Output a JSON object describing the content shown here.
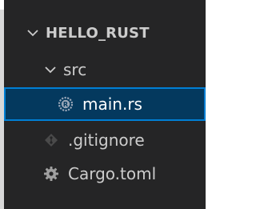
{
  "explorer": {
    "root": {
      "label": "HELLO_RUST",
      "icon": "chevron-down-icon"
    },
    "items": [
      {
        "label": "src",
        "icon": "chevron-down-icon"
      },
      {
        "label": "main.rs",
        "icon": "rust-file-icon",
        "selected": true
      },
      {
        "label": ".gitignore",
        "icon": "gitignore-file-icon"
      },
      {
        "label": "Cargo.toml",
        "icon": "gear-icon"
      }
    ]
  },
  "colors": {
    "background": "#252526",
    "selection_background": "#04395e",
    "selection_border": "#007fd4",
    "text": "#cccccc"
  }
}
